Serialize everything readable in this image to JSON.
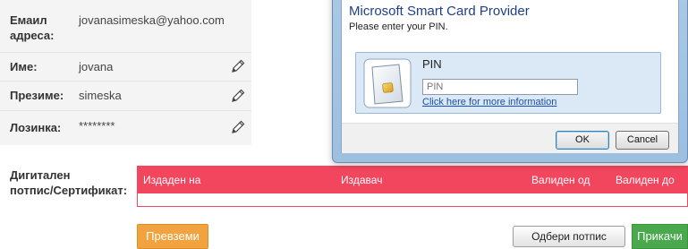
{
  "profile": {
    "email_label_line1": "Емаил",
    "email_label_line2": "адреса:",
    "email_value": "jovanasimeska@yahoo.com",
    "name_label": "Име:",
    "name_value": "jovana",
    "surname_label": "Презиме:",
    "surname_value": "simeska",
    "password_label": "Лозинка:",
    "password_value": "********"
  },
  "signature": {
    "label_line1": "Дигитален",
    "label_line2": "потпис/Сертификат:",
    "columns": [
      "Издаден на",
      "Издавач",
      "Валиден од",
      "Валиден до"
    ],
    "download_label": "Превземи",
    "choose_label": "Одбери потпис",
    "attach_label": "Прикачи"
  },
  "dialog": {
    "title": "Microsoft Smart Card Provider",
    "subtitle": "Please enter your PIN.",
    "pin_heading": "PIN",
    "pin_placeholder": "PIN",
    "more_info_link": "Click here for more information",
    "ok_label": "OK",
    "cancel_label": "Cancel"
  },
  "icons": {
    "edit": "pencil-icon",
    "smart_card": "smart-card-icon"
  },
  "colors": {
    "table_header": "#f2465f",
    "download_button": "#f0a33e",
    "attach_button": "#4aa84d",
    "dialog_title": "#1e3f8a"
  }
}
